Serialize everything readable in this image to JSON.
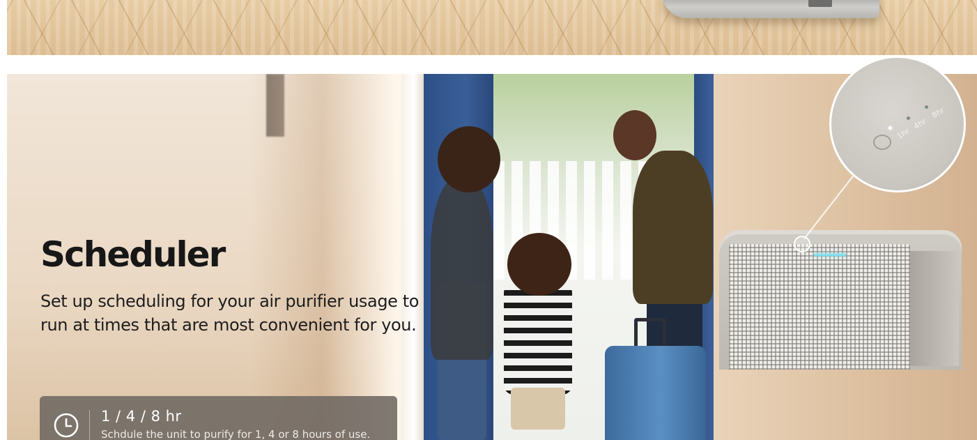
{
  "hero": {
    "title": "Scheduler",
    "subtitle": "Set up scheduling for your air purifier usage to run at times that are most convenient for you."
  },
  "feature_card": {
    "icon": "clock-icon",
    "title": "1 / 4 / 8 hr",
    "description": "Schdule the unit to purify for 1, 4 or 8 hours of use."
  },
  "zoom_panel": {
    "timer_labels": [
      "8hr",
      "4hr",
      "1hr"
    ],
    "active_timer": "1hr",
    "icon": "clock-icon"
  },
  "colors": {
    "title_text": "#171717",
    "card_background": "#6e6862",
    "indicator_light": "#7fe0ef"
  }
}
